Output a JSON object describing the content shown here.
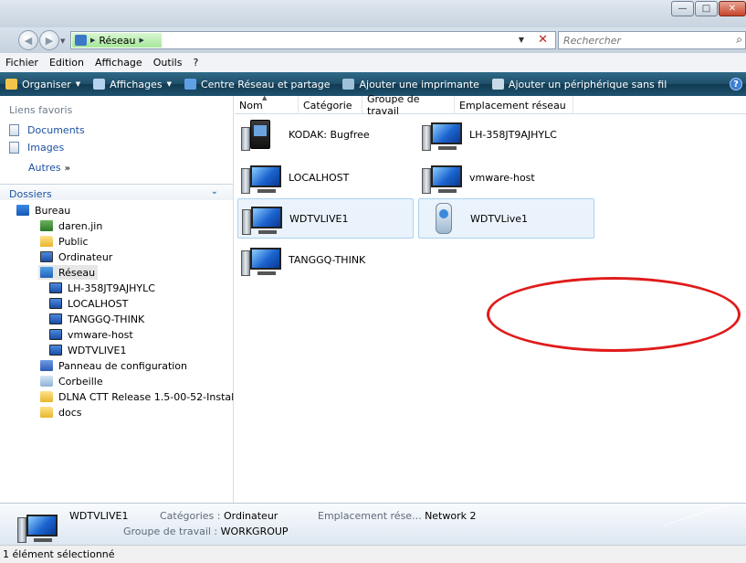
{
  "address": {
    "path": "Réseau",
    "search_placeholder": "Rechercher"
  },
  "menu": [
    "Fichier",
    "Edition",
    "Affichage",
    "Outils",
    "?"
  ],
  "commands": {
    "organize": "Organiser",
    "views": "Affichages",
    "network_center": "Centre Réseau et partage",
    "add_printer": "Ajouter une imprimante",
    "add_wireless": "Ajouter un périphérique sans fil",
    "help": "?"
  },
  "nav": {
    "favorites_header": "Liens favoris",
    "favorites": [
      "Documents",
      "Images"
    ],
    "more": "Autres",
    "more_glyph": "»",
    "folders_header": "Dossiers",
    "tree": [
      {
        "label": "Bureau",
        "icon": "desktop-icon",
        "level": 0
      },
      {
        "label": "daren.jin",
        "icon": "user-folder-icon",
        "level": 1
      },
      {
        "label": "Public",
        "icon": "folder-icon",
        "level": 1
      },
      {
        "label": "Ordinateur",
        "icon": "computer-icon",
        "level": 1
      },
      {
        "label": "Réseau",
        "icon": "network-icon",
        "level": 1,
        "selected": true
      },
      {
        "label": "LH-358JT9AJHYLC",
        "icon": "network-computer-icon",
        "level": 2
      },
      {
        "label": "LOCALHOST",
        "icon": "network-computer-icon",
        "level": 2
      },
      {
        "label": "TANGGQ-THINK",
        "icon": "network-computer-icon",
        "level": 2
      },
      {
        "label": "vmware-host",
        "icon": "network-computer-icon",
        "level": 2
      },
      {
        "label": "WDTVLIVE1",
        "icon": "network-computer-icon",
        "level": 2
      },
      {
        "label": "Panneau de configuration",
        "icon": "control-panel-icon",
        "level": 1
      },
      {
        "label": "Corbeille",
        "icon": "recycle-bin-icon",
        "level": 1
      },
      {
        "label": "DLNA CTT Release 1.5-00-52-Installer",
        "icon": "folder-icon",
        "level": 1
      },
      {
        "label": "docs",
        "icon": "folder-icon",
        "level": 1
      }
    ]
  },
  "columns": [
    "Nom",
    "Catégorie",
    "Groupe de travail",
    "Emplacement réseau"
  ],
  "items": [
    {
      "name": "KODAK: Bugfree",
      "icon": "media-device-icon",
      "selected": false
    },
    {
      "name": "LH-358JT9AJHYLC",
      "icon": "computer-icon",
      "selected": false
    },
    {
      "name": "LOCALHOST",
      "icon": "computer-icon",
      "selected": false
    },
    {
      "name": "vmware-host",
      "icon": "computer-icon",
      "selected": false
    },
    {
      "name": "WDTVLIVE1",
      "icon": "computer-icon",
      "selected": true
    },
    {
      "name": "WDTVLive1",
      "icon": "portable-device-icon",
      "selected": true
    },
    {
      "name": "TANGGQ-THINK",
      "icon": "computer-icon",
      "selected": false
    }
  ],
  "details": {
    "name": "WDTVLIVE1",
    "category_label": "Catégories :",
    "category_value": "Ordinateur",
    "workgroup_label": "Groupe de travail :",
    "workgroup_value": "WORKGROUP",
    "location_label": "Emplacement rése...",
    "location_value": "Network 2"
  },
  "status": "1 élément sélectionné",
  "colors": {
    "annotation": "#e01b1b",
    "command_bar": "#1f4f69",
    "link": "#1d52a2"
  }
}
